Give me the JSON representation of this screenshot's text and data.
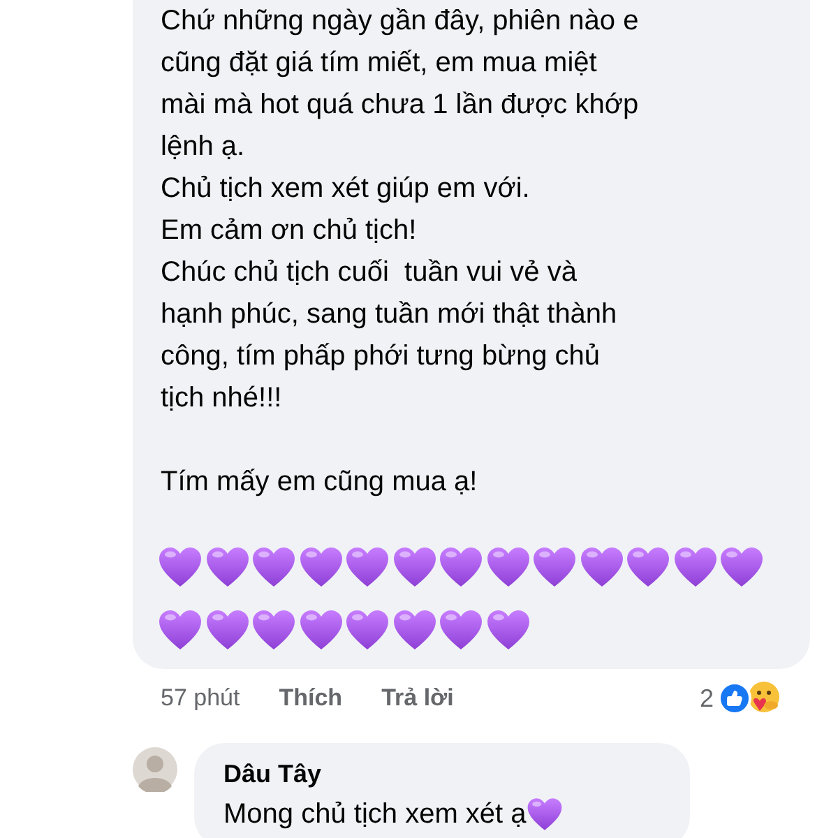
{
  "comment": {
    "paragraphs": [
      [
        "Chứ những ngày gần đây, phiên nào e",
        "cũng đặt giá tím miết, em mua miệt",
        "mài mà hot quá chưa 1 lần được khớp",
        "lệnh ạ.",
        "Chủ tịch xem xét giúp em với.",
        "Em cảm ơn chủ tịch!",
        "Chúc chủ tịch cuối  tuần vui vẻ và",
        "hạnh phúc, sang tuần mới thật thành",
        "công, tím phấp phới tưng bừng chủ",
        "tịch nhé!!!"
      ],
      [
        "Tím mấy em cũng mua ạ!"
      ]
    ],
    "emoji_rows": [
      [
        {
          "kind": "purple_heart"
        },
        {
          "kind": "purple_heart"
        },
        {
          "kind": "purple_heart"
        },
        {
          "kind": "purple_heart"
        },
        {
          "kind": "purple_heart"
        },
        {
          "kind": "purple_heart"
        },
        {
          "kind": "purple_heart"
        },
        {
          "kind": "purple_heart"
        },
        {
          "kind": "purple_heart"
        },
        {
          "kind": "purple_heart"
        },
        {
          "kind": "purple_heart"
        },
        {
          "kind": "purple_heart"
        },
        {
          "kind": "purple_heart"
        }
      ],
      [
        {
          "kind": "purple_heart"
        },
        {
          "kind": "purple_heart"
        },
        {
          "kind": "purple_heart"
        },
        {
          "kind": "purple_heart"
        },
        {
          "kind": "purple_heart"
        },
        {
          "kind": "purple_heart"
        },
        {
          "kind": "purple_heart"
        },
        {
          "kind": "purple_heart"
        }
      ]
    ],
    "time": "57 phút",
    "like": "Thích",
    "reply": "Trả lời",
    "reaction_count": "2",
    "reactions": [
      {
        "kind": "like"
      },
      {
        "kind": "care"
      }
    ]
  },
  "reply": {
    "author": "Dâu Tây",
    "text": "Mong chủ tịch xem xét ạ",
    "emoji": [
      {
        "kind": "purple_heart"
      }
    ]
  }
}
